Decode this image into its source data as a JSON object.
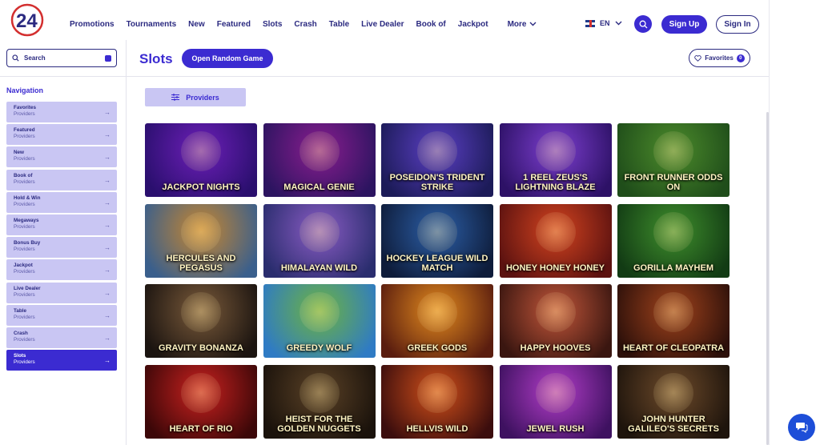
{
  "header": {
    "logo_text": "24",
    "nav": [
      "Promotions",
      "Tournaments",
      "New",
      "Featured",
      "Slots",
      "Crash",
      "Table",
      "Live Dealer",
      "Book of",
      "Jackpot"
    ],
    "more_label": "More",
    "language": "EN",
    "signup_label": "Sign Up",
    "signin_label": "Sign In"
  },
  "sidebar": {
    "search_placeholder": "Search",
    "nav_title": "Navigation",
    "items": [
      {
        "label": "Favorites",
        "sub": "Providers"
      },
      {
        "label": "Featured",
        "sub": "Providers"
      },
      {
        "label": "New",
        "sub": "Providers"
      },
      {
        "label": "Book of",
        "sub": "Providers"
      },
      {
        "label": "Hold & Win",
        "sub": "Providers"
      },
      {
        "label": "Megaways",
        "sub": "Providers"
      },
      {
        "label": "Bonus Buy",
        "sub": "Providers"
      },
      {
        "label": "Jackpot",
        "sub": "Providers"
      },
      {
        "label": "Live Dealer",
        "sub": "Providers"
      },
      {
        "label": "Table",
        "sub": "Providers"
      },
      {
        "label": "Crash",
        "sub": "Providers"
      },
      {
        "label": "Slots",
        "sub": "Providers",
        "active": true
      }
    ]
  },
  "main": {
    "title": "Slots",
    "random_label": "Open Random Game",
    "favorites_label": "Favorites",
    "favorites_count": "0",
    "providers_label": "Providers",
    "games": [
      {
        "title": "Jackpot Nights",
        "bg1": "#6d1fb8",
        "bg2": "#2a0f6e"
      },
      {
        "title": "Magical Genie",
        "bg1": "#8a1d8f",
        "bg2": "#2c1460"
      },
      {
        "title": "Poseidon's Trident Strike",
        "bg1": "#5b3fc4",
        "bg2": "#1c1b58"
      },
      {
        "title": "1 Reel Zeus's Lightning Blaze",
        "bg1": "#7d3fd0",
        "bg2": "#2d1166"
      },
      {
        "title": "Front Runner Odds On",
        "bg1": "#4c8b2b",
        "bg2": "#1f4d1a"
      },
      {
        "title": "Hercules and Pegasus",
        "bg1": "#c7862f",
        "bg2": "#3a5f8c"
      },
      {
        "title": "Himalayan Wild",
        "bg1": "#8a5cc4",
        "bg2": "#2a2d6e"
      },
      {
        "title": "Hockey League Wild Match",
        "bg1": "#2c5fa8",
        "bg2": "#0e1c3a"
      },
      {
        "title": "Honey Honey Honey",
        "bg1": "#d3431f",
        "bg2": "#5c1210"
      },
      {
        "title": "Gorilla Mayhem",
        "bg1": "#3f8f2c",
        "bg2": "#123b14"
      },
      {
        "title": "Gravity Bonanza",
        "bg1": "#7a5a3a",
        "bg2": "#1b1410"
      },
      {
        "title": "Greedy Wolf",
        "bg1": "#6db33f",
        "bg2": "#2f7bc4"
      },
      {
        "title": "Greek Gods",
        "bg1": "#e28a1e",
        "bg2": "#5a1d0f"
      },
      {
        "title": "Happy Hooves",
        "bg1": "#c2563a",
        "bg2": "#3a1610"
      },
      {
        "title": "Heart of Cleopatra",
        "bg1": "#a1431c",
        "bg2": "#2d100a"
      },
      {
        "title": "Heart of Rio",
        "bg1": "#c9211f",
        "bg2": "#3c0708"
      },
      {
        "title": "Heist for the Golden Nuggets",
        "bg1": "#5a4126",
        "bg2": "#1a120b"
      },
      {
        "title": "Hellvis Wild",
        "bg1": "#d2501a",
        "bg2": "#3b0d0d"
      },
      {
        "title": "Jewel Rush",
        "bg1": "#b23dc8",
        "bg2": "#3e1160"
      },
      {
        "title": "John Hunter Galileo's Secrets",
        "bg1": "#6d4a2a",
        "bg2": "#1e140c"
      }
    ]
  },
  "colors": {
    "accent": "#3b2bd1",
    "navy": "#2b2a80",
    "sidebar_item": "#c9c6f3"
  }
}
